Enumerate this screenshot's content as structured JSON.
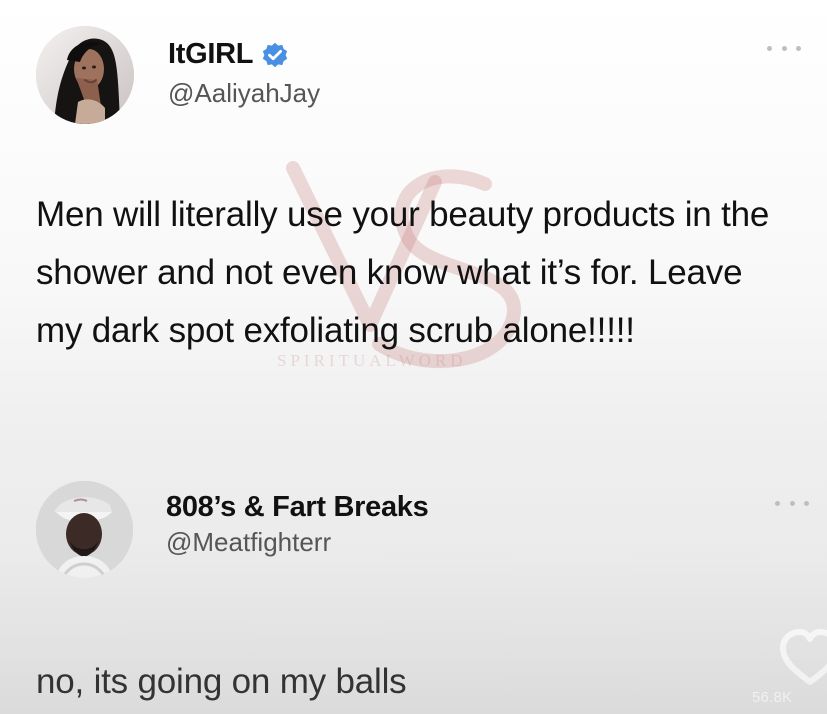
{
  "colors": {
    "verified": "#4A90E2",
    "text_primary": "#111111",
    "text_secondary": "#555555",
    "watermark": "#c77a7a",
    "icon_white": "#ffffff"
  },
  "primary_tweet": {
    "display_name": "ItGIRL",
    "handle": "@AaliyahJay",
    "text": "Men will literally use your beauty products in the shower and not even know what it’s for. Leave my dark spot exfoliating scrub alone!!!!!",
    "verified_icon": "verified-badge-icon",
    "more_icon": "more-options-icon"
  },
  "reply_tweet": {
    "display_name": "808’s & Fart Breaks",
    "handle": "@Meatfighterr",
    "text": "no, its going on my balls",
    "more_icon": "more-options-icon",
    "like_icon": "heart-icon",
    "like_count": "56.8K"
  }
}
